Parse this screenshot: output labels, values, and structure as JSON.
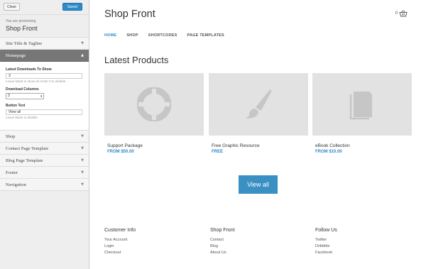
{
  "customizer": {
    "close_label": "Close",
    "saved_label": "Saved",
    "previewing_label": "You are previewing",
    "theme_name": "Shop Front",
    "sections": {
      "site_title": "Site Title & Tagline",
      "homepage": "Homepage",
      "shop": "Shop",
      "contact": "Contact Page Template",
      "blog": "Blog Page Template",
      "footer": "Footer",
      "navigation": "Navigation"
    },
    "homepage_fields": {
      "downloads_label": "Latest Downloads To Show",
      "downloads_value": "3",
      "downloads_help": "Leave blank to show all. Enter 0 to disable.",
      "columns_label": "Download Columns",
      "columns_value": "3",
      "button_label": "Button Text",
      "button_value": "View all",
      "button_help": "Leave blank to disable."
    }
  },
  "site": {
    "title": "Shop Front",
    "cart_count": "0",
    "nav": [
      "HOME",
      "SHOP",
      "SHORTCODES",
      "PAGE TEMPLATES"
    ],
    "products_heading": "Latest Products",
    "products": [
      {
        "name": "Support Package",
        "price": "FROM $50.00",
        "icon": "lifebuoy-icon"
      },
      {
        "name": "Free Graphic Resource",
        "price": "FREE",
        "icon": "paintbrush-icon"
      },
      {
        "name": "eBook Collection",
        "price": "FROM $10.00",
        "icon": "book-icon"
      }
    ],
    "view_all": "View all",
    "footer": [
      {
        "title": "Customer Info",
        "links": [
          "Your Account",
          "Login",
          "Checkout"
        ]
      },
      {
        "title": "Shop Front",
        "links": [
          "Contact",
          "Blog",
          "About Us"
        ]
      },
      {
        "title": "Follow Us",
        "links": [
          "Twitter",
          "Dribbble",
          "Facebook"
        ]
      }
    ]
  },
  "colors": {
    "accent": "#2e8bc9",
    "button": "#3a8fc3",
    "thumb": "#e2e2e2",
    "icon": "#c6c6c6"
  }
}
